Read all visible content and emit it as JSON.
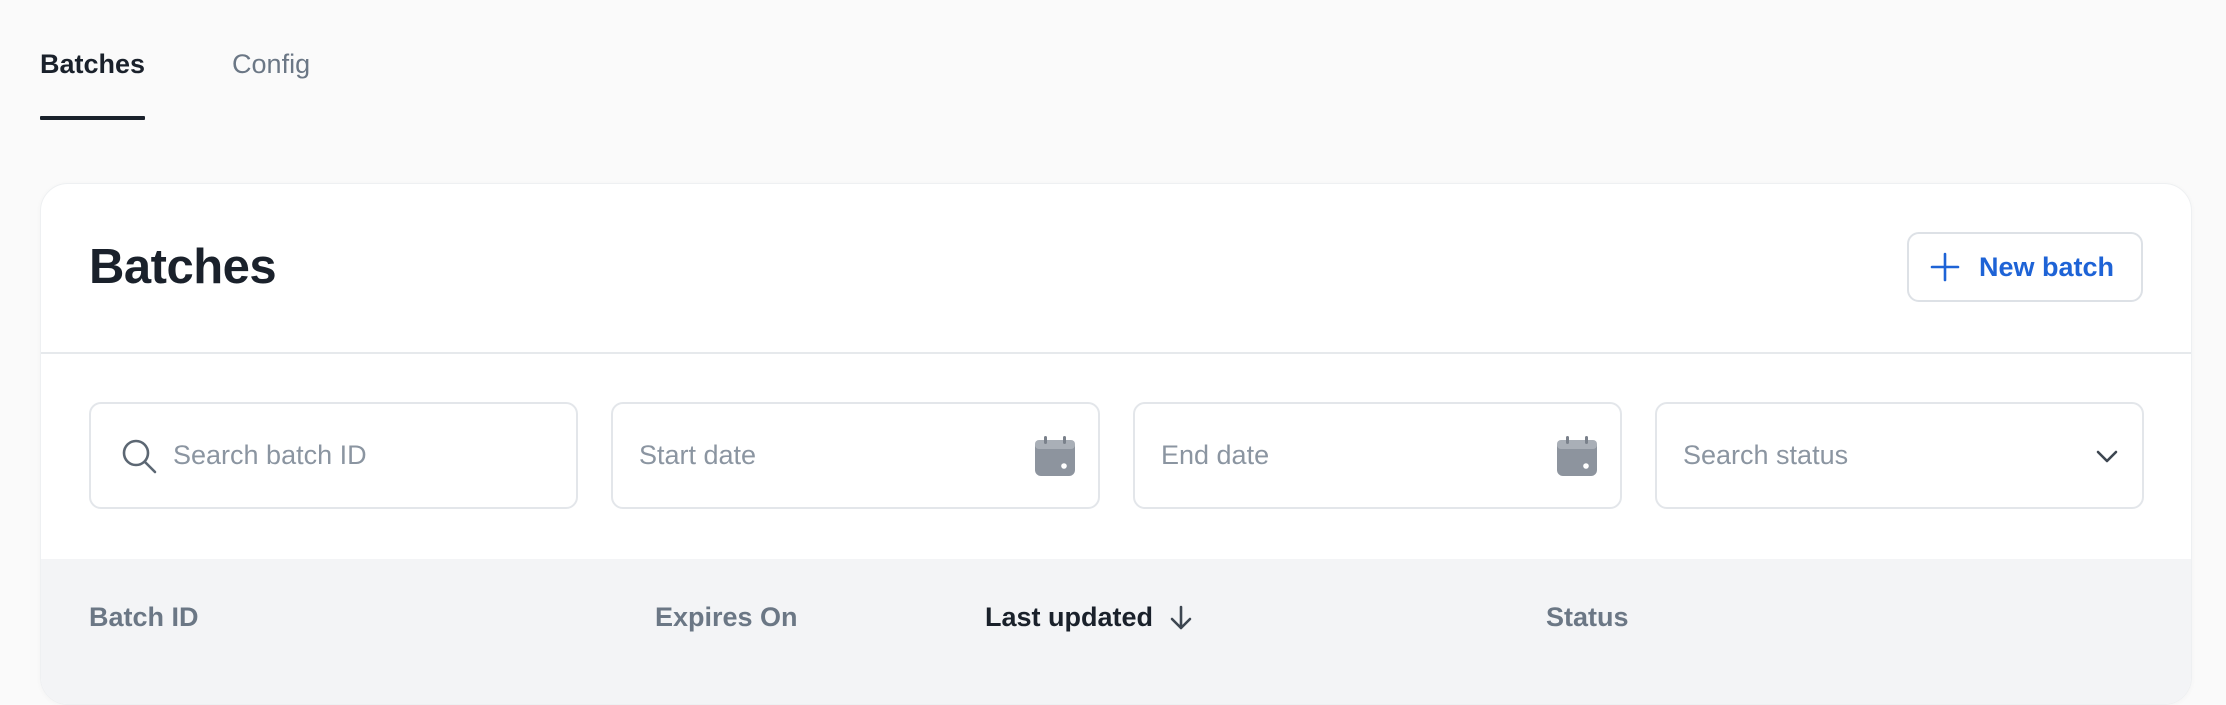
{
  "tabs": [
    {
      "label": "Batches",
      "active": true
    },
    {
      "label": "Config",
      "active": false
    }
  ],
  "card": {
    "title": "Batches",
    "new_batch_button": {
      "label": "New batch",
      "icon": "plus-icon"
    }
  },
  "filters": {
    "search": {
      "placeholder": "Search batch ID",
      "value": "",
      "icon": "search-icon"
    },
    "start_date": {
      "placeholder": "Start date",
      "value": "",
      "icon": "calendar-icon"
    },
    "end_date": {
      "placeholder": "End date",
      "value": "",
      "icon": "calendar-icon"
    },
    "status": {
      "placeholder": "Search status",
      "value": "",
      "icon": "chevron-down-icon"
    }
  },
  "table": {
    "columns": [
      {
        "label": "Batch ID"
      },
      {
        "label": "Expires On"
      },
      {
        "label": "Last updated",
        "sort": "descending"
      },
      {
        "label": "Status"
      }
    ]
  },
  "colors": {
    "accent": "#1e63d6",
    "text_primary": "#1a212b",
    "text_muted": "#6b7785",
    "header_bg": "#f3f4f6"
  }
}
